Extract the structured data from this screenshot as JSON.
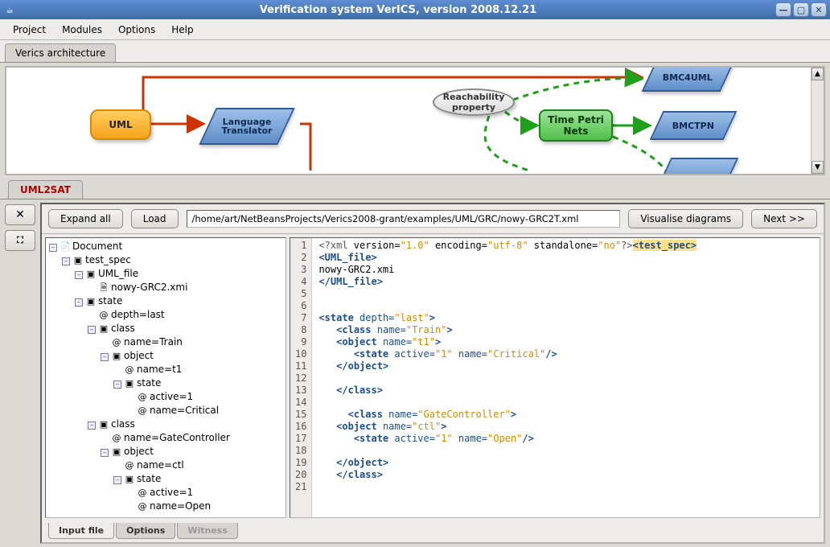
{
  "window": {
    "title": "Verification system VerICS, version 2008.12.21"
  },
  "menubar": {
    "project": "Project",
    "modules": "Modules",
    "options": "Options",
    "help": "Help"
  },
  "arch": {
    "tab_label": "Verics architecture",
    "uml": "UML",
    "lang_translator": "Language\nTranslator",
    "reachability": "Reachability\nproperty",
    "tpn": "Time Petri\nNets",
    "bmc4uml": "BMC4UML",
    "bmctpn": "BMCTPN"
  },
  "lower_tab": {
    "uml2sat": "UML2SAT"
  },
  "toolbar": {
    "expand_all": "Expand all",
    "load": "Load",
    "path": "/home/art/NetBeansProjects/Verics2008-grant/examples/UML/GRC/nowy-GRC2T.xml",
    "visualise": "Visualise diagrams",
    "next": "Next >>"
  },
  "tree": {
    "document": "Document",
    "test_spec": "test_spec",
    "uml_file": "UML_file",
    "uml_file_child": "nowy-GRC2.xmi",
    "state": "state",
    "depth_last": "depth=last",
    "class": "class",
    "name_train": "name=Train",
    "object": "object",
    "name_t1": "name=t1",
    "state2": "state",
    "active_1": "active=1",
    "name_critical": "name=Critical",
    "class2": "class",
    "name_gc": "name=GateController",
    "object2": "object",
    "name_ctl": "name=ctl",
    "state3": "state",
    "active_1b": "active=1",
    "name_open": "name=Open"
  },
  "code_lines": [
    {
      "n": 1,
      "html": "<span class='s-pi'>&lt;?xml</span> version=<span class='s-str'>\"1.0\"</span> encoding=<span class='s-str'>\"utf-8\"</span> standalone=<span class='s-str'>\"no\"</span><span class='s-pi'>?&gt;</span><span class='s-hl'><span class='s-elem'>&lt;test_spec&gt;</span></span>"
    },
    {
      "n": 2,
      "html": "<span class='s-elem'>&lt;UML_file&gt;</span>"
    },
    {
      "n": 3,
      "html": "nowy-GRC2.xmi"
    },
    {
      "n": 4,
      "html": "<span class='s-elem'>&lt;/UML_file&gt;</span>"
    },
    {
      "n": 5,
      "html": ""
    },
    {
      "n": 6,
      "html": ""
    },
    {
      "n": 7,
      "html": "<span class='s-elem'>&lt;state</span> <span class='s-attr'>depth=</span><span class='s-str'>\"last\"</span><span class='s-elem'>&gt;</span>"
    },
    {
      "n": 8,
      "html": "   <span class='s-elem'>&lt;class</span> <span class='s-attr'>name=</span><span class='s-str'>\"Train\"</span><span class='s-elem'>&gt;</span>"
    },
    {
      "n": 9,
      "html": "   <span class='s-elem'>&lt;object</span> <span class='s-attr'>name=</span><span class='s-str'>\"t1\"</span><span class='s-elem'>&gt;</span>"
    },
    {
      "n": 10,
      "html": "      <span class='s-elem'>&lt;state</span> <span class='s-attr'>active=</span><span class='s-str'>\"1\"</span> <span class='s-attr'>name=</span><span class='s-str'>\"Critical\"</span><span class='s-elem'>/&gt;</span>"
    },
    {
      "n": 11,
      "html": "   <span class='s-elem'>&lt;/object&gt;</span>"
    },
    {
      "n": 12,
      "html": ""
    },
    {
      "n": 13,
      "html": "   <span class='s-elem'>&lt;/class&gt;</span>"
    },
    {
      "n": 14,
      "html": ""
    },
    {
      "n": 15,
      "html": "     <span class='s-elem'>&lt;class</span> <span class='s-attr'>name=</span><span class='s-str'>\"GateController\"</span><span class='s-elem'>&gt;</span>"
    },
    {
      "n": 16,
      "html": "   <span class='s-elem'>&lt;object</span> <span class='s-attr'>name=</span><span class='s-str'>\"ctl\"</span><span class='s-elem'>&gt;</span>"
    },
    {
      "n": 17,
      "html": "      <span class='s-elem'>&lt;state</span> <span class='s-attr'>active=</span><span class='s-str'>\"1\"</span> <span class='s-attr'>name=</span><span class='s-str'>\"Open\"</span><span class='s-elem'>/&gt;</span>"
    },
    {
      "n": 18,
      "html": ""
    },
    {
      "n": 19,
      "html": "   <span class='s-elem'>&lt;/object&gt;</span>"
    },
    {
      "n": 20,
      "html": "   <span class='s-elem'>&lt;/class&gt;</span>"
    },
    {
      "n": 21,
      "html": ""
    }
  ],
  "bottom_tabs": {
    "input_file": "Input file",
    "options": "Options",
    "witness": "Witness"
  }
}
